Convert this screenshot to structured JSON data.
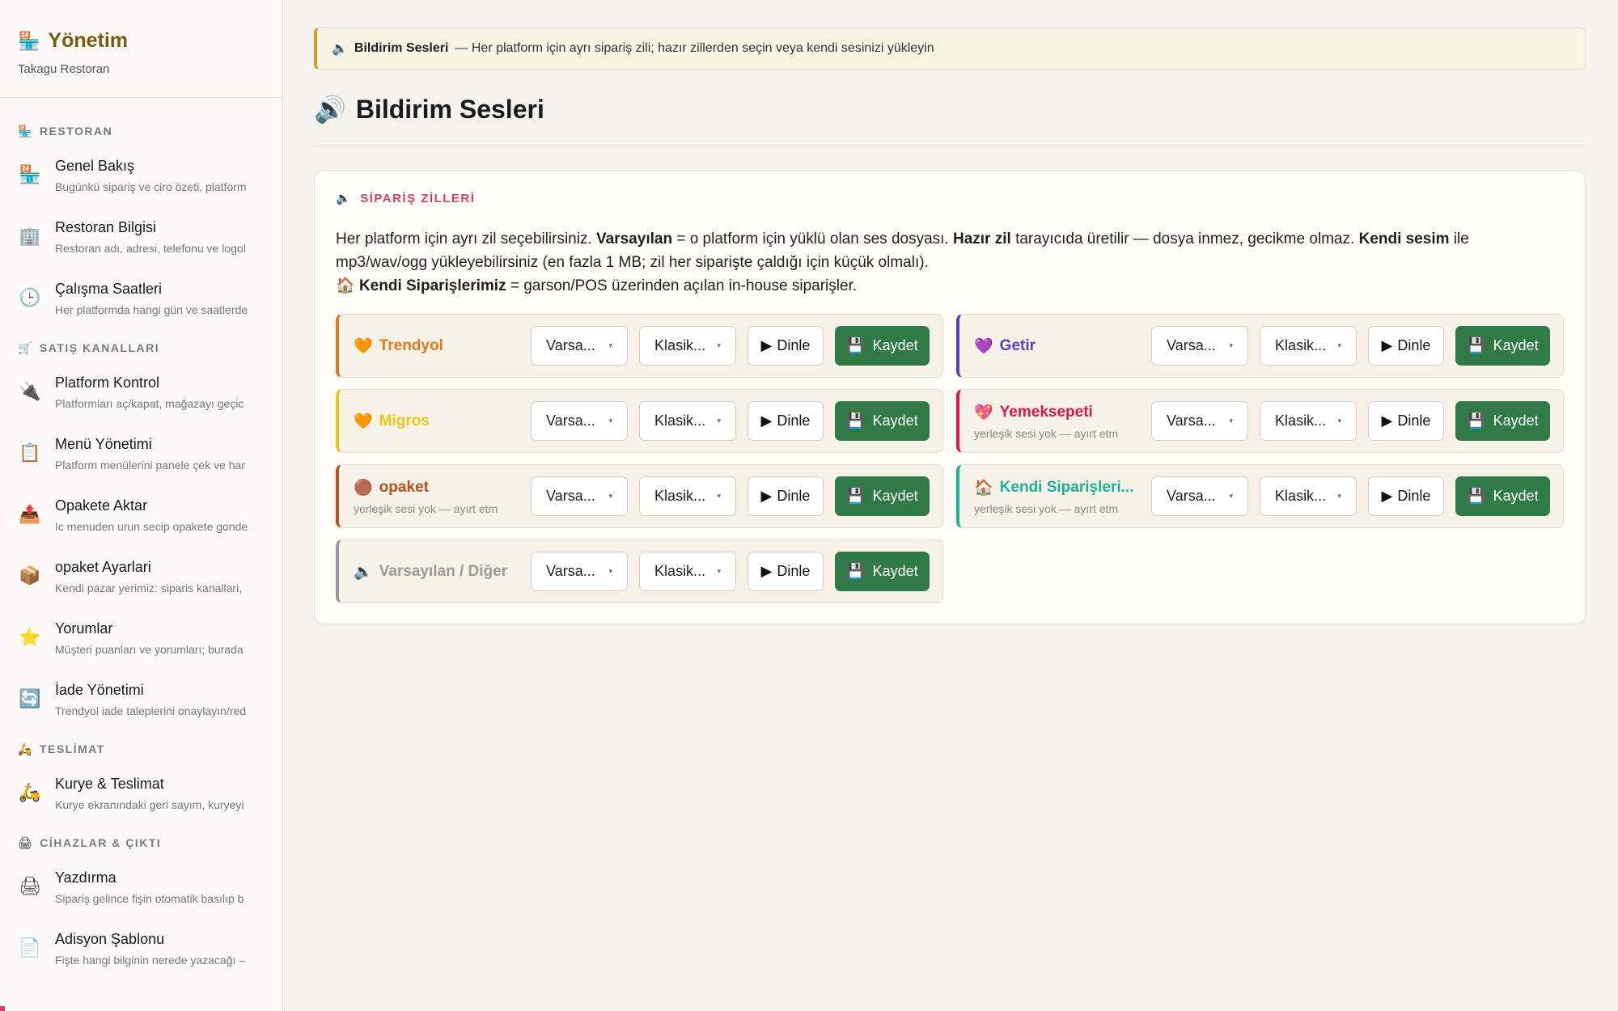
{
  "sidebar": {
    "brand_icon": "🏪",
    "brand_title": "Yönetim",
    "brand_sub": "Takagu Restoran",
    "sections": [
      {
        "label": "RESTORAN",
        "icon": "🏪",
        "items": [
          {
            "icon": "🏪",
            "title": "Genel Bakış",
            "desc": "Bugünkü sipariş ve ciro özeti, platform"
          },
          {
            "icon": "🏢",
            "title": "Restoran Bilgisi",
            "desc": "Restoran adı, adresi, telefonu ve logol"
          },
          {
            "icon": "🕒",
            "title": "Çalışma Saatleri",
            "desc": "Her platformda hangi gün ve saatlerde"
          }
        ]
      },
      {
        "label": "SATIŞ KANALLARI",
        "icon": "🛒",
        "items": [
          {
            "icon": "🔌",
            "title": "Platform Kontrol",
            "desc": "Platformları aç/kapat, mağazayı geçic"
          },
          {
            "icon": "📋",
            "title": "Menü Yönetimi",
            "desc": "Platform menülerini panele çek ve har"
          },
          {
            "icon": "📤",
            "title": "Opakete Aktar",
            "desc": "Ic menuden urun secip opakete gonde"
          },
          {
            "icon": "📦",
            "title": "opaket Ayarlari",
            "desc": "Kendi pazar yerimiz: siparis kanallari,"
          },
          {
            "icon": "⭐",
            "title": "Yorumlar",
            "desc": "Müşteri puanları ve yorumları; burada"
          },
          {
            "icon": "🔄",
            "title": "İade Yönetimi",
            "desc": "Trendyol iade taleplerini onaylayın/red"
          }
        ]
      },
      {
        "label": "TESLİMAT",
        "icon": "🛵",
        "items": [
          {
            "icon": "🛵",
            "title": "Kurye & Teslimat",
            "desc": "Kurye ekranındaki geri sayım, kuryeyi"
          }
        ]
      },
      {
        "label": "CİHAZLAR & ÇIKTI",
        "icon": "🖨",
        "items": [
          {
            "icon": "🖨",
            "title": "Yazdırma",
            "desc": "Sipariş gelince fişin otomatik basılıp b"
          },
          {
            "icon": "📄",
            "title": "Adisyon Şablonu",
            "desc": "Fişte hangi bilginin nerede yazacağı –"
          }
        ]
      }
    ]
  },
  "banner": {
    "icon": "🔈",
    "title": "Bildirim Sesleri",
    "text": "— Her platform için ayrı sipariş zili; hazır zillerden seçin veya kendi sesinizi yükleyin"
  },
  "page_title": {
    "icon": "🔊",
    "text": "Bildirim Sesleri"
  },
  "card": {
    "label_icon": "🔈",
    "label": "SİPARİŞ ZİLLERİ",
    "desc": {
      "p1": "Her platform için ayrı zil seçebilirsiniz. ",
      "b1": "Varsayılan",
      "p2": " = o platform için yüklü olan ses dosyası. ",
      "b2": "Hazır zil",
      "p3": " tarayıcıda üretilir — dosya inmez, gecikme olmaz. ",
      "b3": "Kendi sesim",
      "p4": " ile mp3/wav/ogg yükleyebilirsiniz (en fazla 1 MB; zil her siparişte çaldığı için küçük olmalı).",
      "l2_icon": "🏠",
      "b4": "Kendi Siparişlerimiz",
      "p5": " = garson/POS üzerinden açılan in-house siparişler."
    },
    "rows": [
      {
        "icon": "🧡",
        "name": "Trendyol",
        "sub": "",
        "color": "#e8761e",
        "select1": "Varsa...",
        "select2": "Klasik...",
        "listen": "Dinle",
        "save": "Kaydet"
      },
      {
        "icon": "💜",
        "name": "Getir",
        "sub": "",
        "color": "#5c3eb8",
        "select1": "Varsa...",
        "select2": "Klasik...",
        "listen": "Dinle",
        "save": "Kaydet"
      },
      {
        "icon": "🧡",
        "name": "Migros",
        "sub": "",
        "color": "#f2c318",
        "select1": "Varsa...",
        "select2": "Klasik...",
        "listen": "Dinle",
        "save": "Kaydet"
      },
      {
        "icon": "💖",
        "name": "Yemeksepeti",
        "sub": "yerleşik sesi yok — ayırt etm",
        "color": "#d9184f",
        "select1": "Varsa...",
        "select2": "Klasik...",
        "listen": "Dinle",
        "save": "Kaydet"
      },
      {
        "icon": "🟤",
        "name": "opaket",
        "sub": "yerleşik sesi yok — ayırt etm",
        "color": "#b8501e",
        "select1": "Varsa...",
        "select2": "Klasik...",
        "listen": "Dinle",
        "save": "Kaydet"
      },
      {
        "icon": "🏠",
        "name": "Kendi Siparişleri...",
        "sub": "yerleşik sesi yok — ayırt etm",
        "color": "#1fae98",
        "select1": "Varsa...",
        "select2": "Klasik...",
        "listen": "Dinle",
        "save": "Kaydet"
      },
      {
        "icon": "🔈",
        "name": "Varsayılan / Diğer",
        "sub": "",
        "color": "#9a9a9a",
        "select1": "Varsa...",
        "select2": "Klasik...",
        "listen": "Dinle",
        "save": "Kaydet"
      }
    ]
  },
  "icons": {
    "play": "▶",
    "save": "💾",
    "caret": "▾"
  }
}
